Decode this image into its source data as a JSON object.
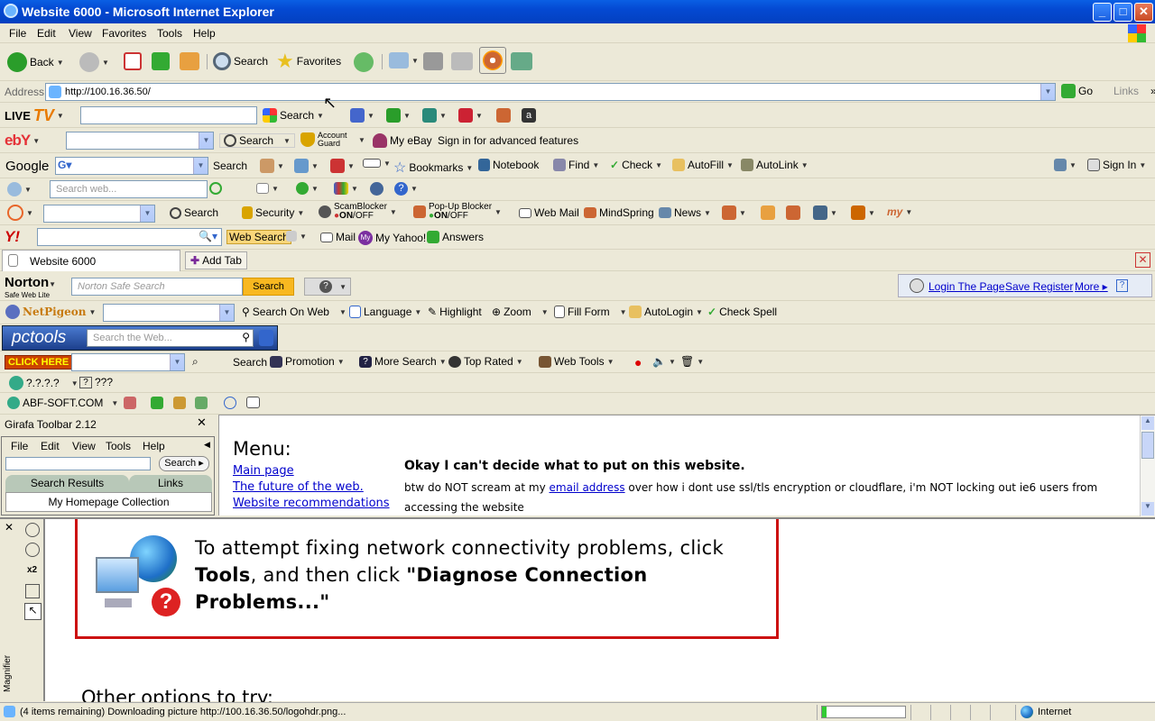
{
  "window": {
    "title": "Website 6000 - Microsoft Internet Explorer",
    "minimize": "_",
    "maximize": "□",
    "close": "✕"
  },
  "menu": [
    "File",
    "Edit",
    "View",
    "Favorites",
    "Tools",
    "Help"
  ],
  "standard_toolbar": {
    "back": "Back",
    "search": "Search",
    "favorites": "Favorites"
  },
  "address": {
    "label": "Address",
    "url": "http://100.16.36.50/",
    "go": "Go",
    "links": "Links"
  },
  "livetv": {
    "logo_live": "LIVE",
    "logo_tv": "TV",
    "search": "Search"
  },
  "ebay": {
    "logo": "ebY",
    "search": "Search",
    "account_guard": "Account Guard",
    "my_ebay": "My eBay",
    "sign_in": "Sign in for advanced features"
  },
  "google": {
    "logo": "Google",
    "search": "Search",
    "bookmarks": "Bookmarks",
    "notebook": "Notebook",
    "find": "Find",
    "check": "Check",
    "autofill": "AutoFill",
    "autolink": "AutoLink",
    "sign_in": "Sign In"
  },
  "web_search_bar": {
    "placeholder": "Search web..."
  },
  "earthlink": {
    "search": "Search",
    "security": "Security",
    "scamblocker": "ScamBlocker",
    "popup_blocker": "Pop-Up Blocker",
    "on": "ON",
    "off": "OFF",
    "webmail": "Web Mail",
    "mindspring": "MindSpring",
    "news": "News"
  },
  "yahoo": {
    "logo": "Y!",
    "web_search": "Web Search",
    "mail": "Mail",
    "my_yahoo": "My Yahoo!",
    "answers": "Answers"
  },
  "tabs": {
    "current": "Website 6000",
    "add": "Add Tab"
  },
  "norton": {
    "logo": "Norton",
    "sub": "Safe Web Lite",
    "placeholder": "Norton Safe Search",
    "search": "Search",
    "login": "Login The Page",
    "save_register": "Save Register",
    "more": "More",
    "help": "?"
  },
  "netpigeon": {
    "logo": "NetPigeon",
    "search_on_web": "Search On Web",
    "language": "Language",
    "highlight": "Highlight",
    "zoom": "Zoom",
    "fill_form": "Fill Form",
    "autologin": "AutoLogin",
    "check_spell": "Check Spell"
  },
  "pctools": {
    "logo": "pctools",
    "placeholder": "Search the Web..."
  },
  "clickhere": {
    "logo": "CLICK HERE",
    "search": "Search",
    "promotion": "Promotion",
    "more_search": "More Search",
    "top_rated": "Top Rated",
    "web_tools": "Web Tools"
  },
  "misc_bar": {
    "label1": "?.?.?.?",
    "label2": "???"
  },
  "abf": {
    "label": "ABF-SOFT.COM"
  },
  "girafa": {
    "title": "Girafa Toolbar 2.12",
    "menu": [
      "File",
      "Edit",
      "View",
      "Tools",
      "Help"
    ],
    "search": "Search",
    "tab_results": "Search Results",
    "tab_links": "Links",
    "collection": "My Homepage Collection"
  },
  "page": {
    "menu_heading": "Menu:",
    "menu_links": [
      "Main page",
      "The future of the web.",
      "Website recommendations"
    ],
    "headline": "Okay I can't decide what to put on this website.",
    "body_pre": "btw do NOT scream at my ",
    "body_link": "email address",
    "body_post": " over how i dont use ssl/tls encryption or cloudflare, i'm NOT locking out ie6 users from accessing the website"
  },
  "magnifier": {
    "label": "Magnifier",
    "zoom": "x2",
    "line1": "To attempt fixing network connectivity problems, click",
    "line2_bold": "Tools",
    "line2_rest": ", and then click ",
    "line2_quote": "\"Diagnose Connection",
    "line3": "Problems...\"",
    "other_options": "Other options to try:"
  },
  "status": {
    "text": "(4 items remaining) Downloading picture http://100.16.36.50/logohdr.png...",
    "zone": "Internet",
    "progress": 0.05
  },
  "colors": {
    "xp_blue": "#0449d2",
    "red_border": "#cc1111",
    "link": "#0000cc"
  }
}
